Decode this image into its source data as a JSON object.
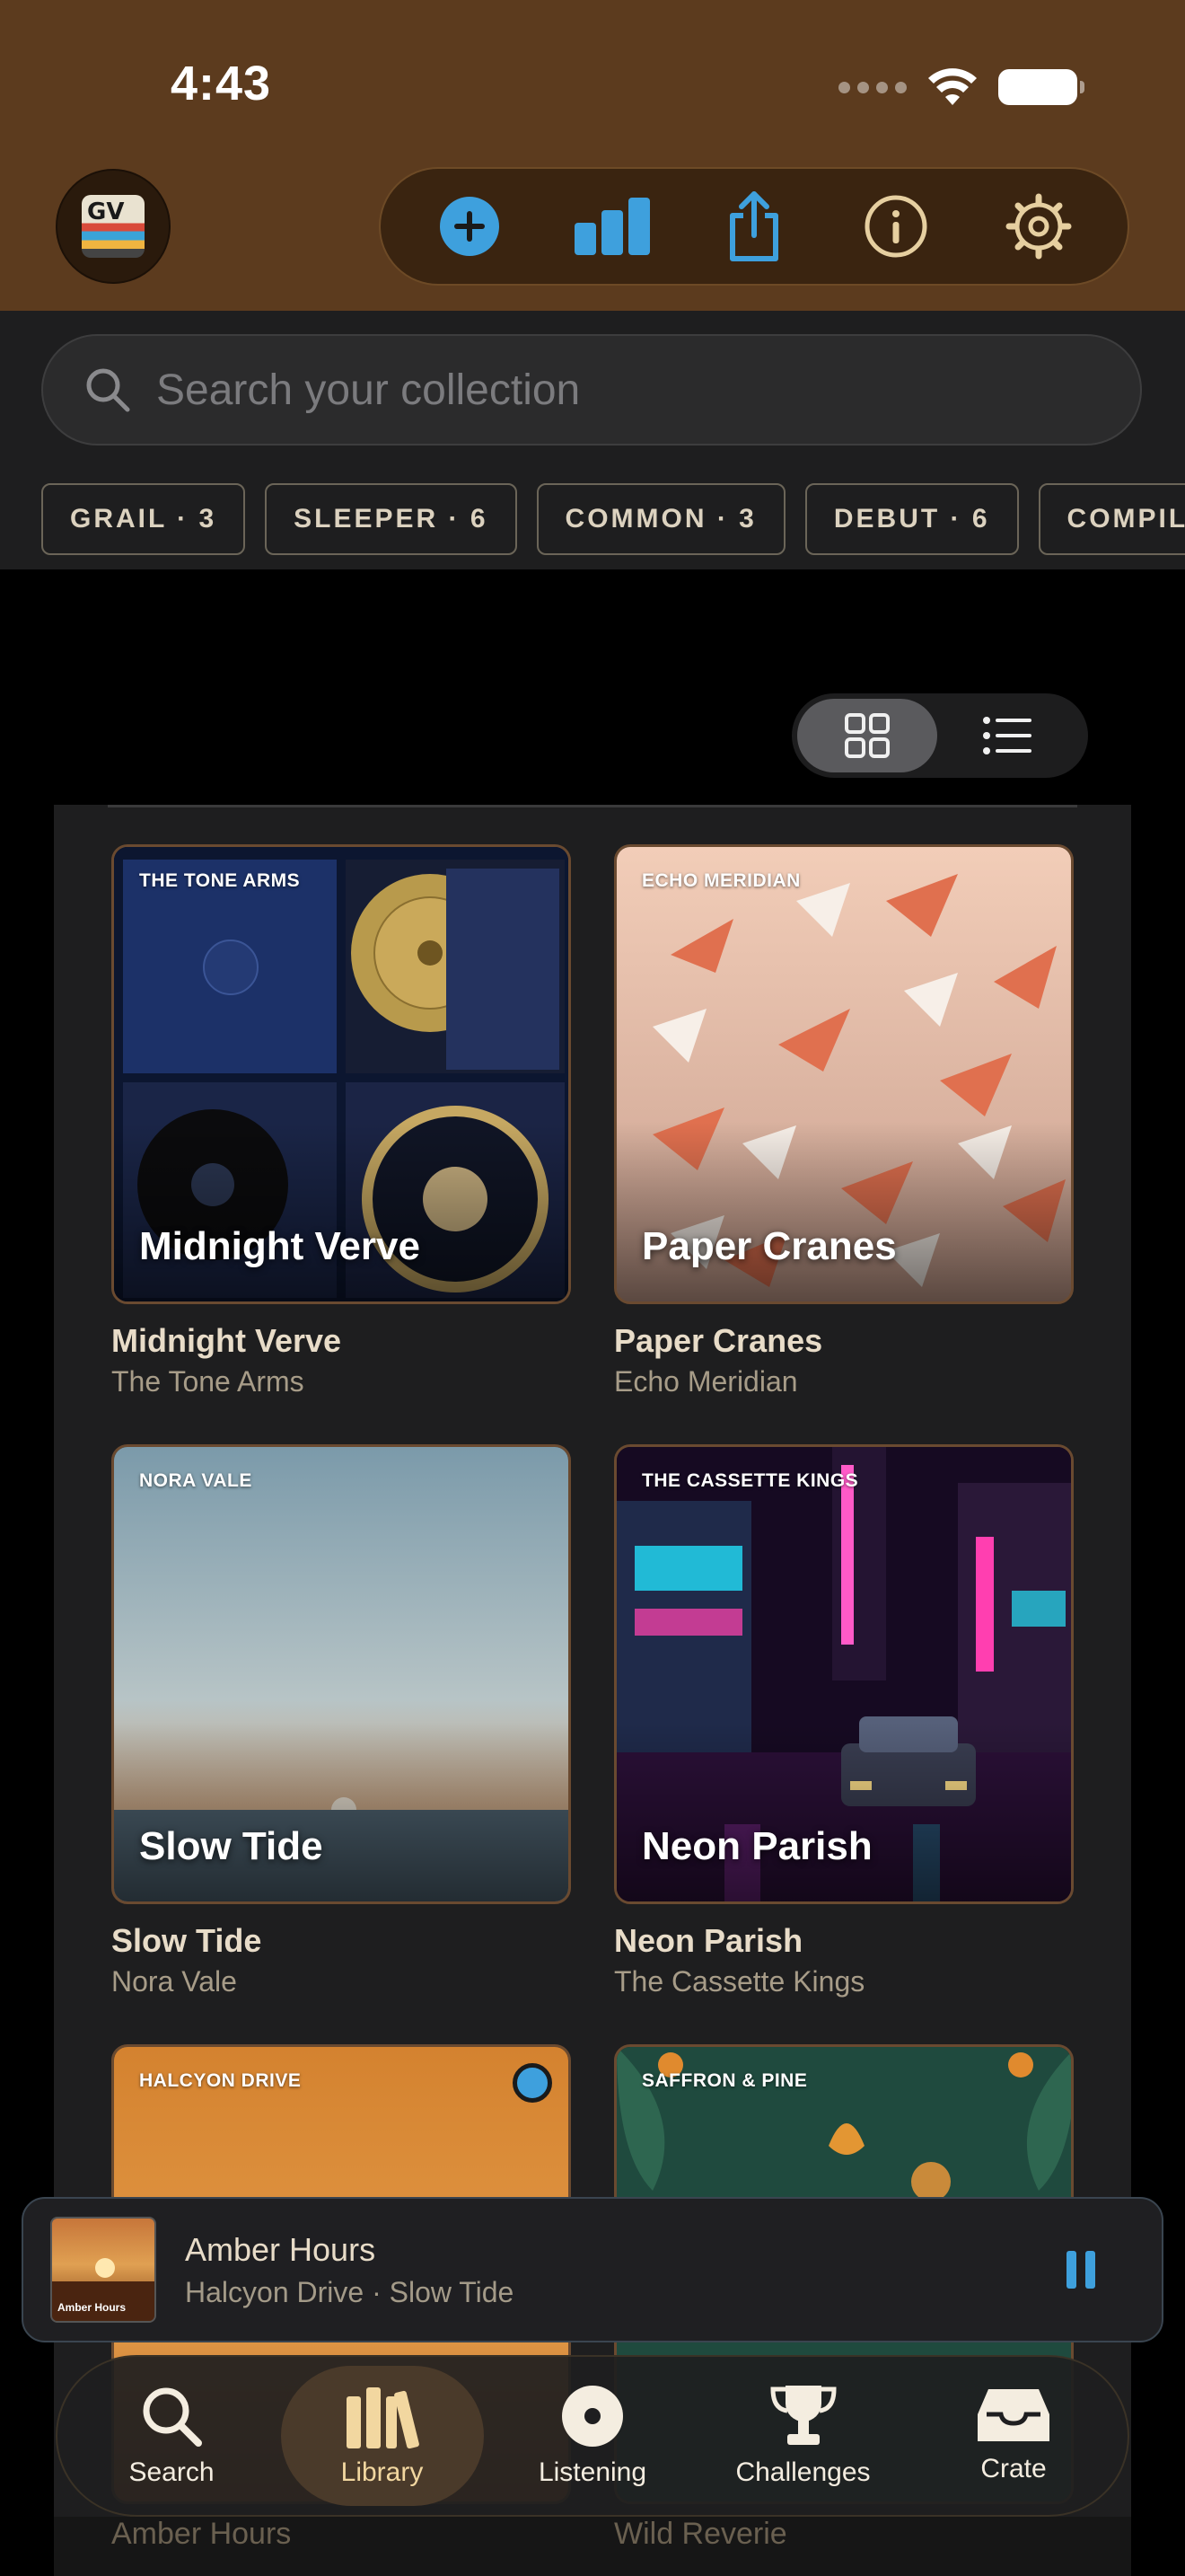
{
  "status_bar": {
    "time": "4:43"
  },
  "toolbar": {
    "add_icon": "plus-circle-icon",
    "stats_icon": "bar-chart-icon",
    "share_icon": "share-icon",
    "info_icon": "info-icon",
    "settings_icon": "gear-icon"
  },
  "search": {
    "placeholder": "Search your collection",
    "value": ""
  },
  "filters": [
    {
      "label": "GRAIL · 3"
    },
    {
      "label": "SLEEPER · 6"
    },
    {
      "label": "COMMON · 3"
    },
    {
      "label": "DEBUT · 6"
    },
    {
      "label": "COMPIL"
    }
  ],
  "view_toggle": {
    "active": "grid"
  },
  "albums": [
    {
      "title": "Midnight Verve",
      "artist": "The Tone Arms",
      "cover_tag": "THE TONE ARMS"
    },
    {
      "title": "Paper Cranes",
      "artist": "Echo Meridian",
      "cover_tag": "ECHO MERIDIAN"
    },
    {
      "title": "Slow Tide",
      "artist": "Nora Vale",
      "cover_tag": "NORA VALE"
    },
    {
      "title": "Neon Parish",
      "artist": "The Cassette Kings",
      "cover_tag": "THE CASSETTE KINGS"
    },
    {
      "title": "Amber Hours",
      "artist": "Halcyon Drive",
      "cover_tag": "HALCYON DRIVE"
    },
    {
      "title": "Wild Reverie",
      "artist": "Saffron & Pine",
      "cover_tag": "SAFFRON & PINE"
    }
  ],
  "now_playing": {
    "title": "Amber Hours",
    "subtitle": "Halcyon Drive · Slow Tide",
    "thumb_caption": "Amber Hours"
  },
  "tabs": [
    {
      "label": "Search",
      "icon": "search-icon"
    },
    {
      "label": "Library",
      "icon": "books-icon",
      "active": true
    },
    {
      "label": "Listening",
      "icon": "record-icon"
    },
    {
      "label": "Challenges",
      "icon": "trophy-icon"
    },
    {
      "label": "Crate",
      "icon": "tray-icon"
    }
  ],
  "colors": {
    "header_brown": "#5c3b1e",
    "accent_blue": "#3ea0dd",
    "cream_text": "#e8dcc8"
  }
}
